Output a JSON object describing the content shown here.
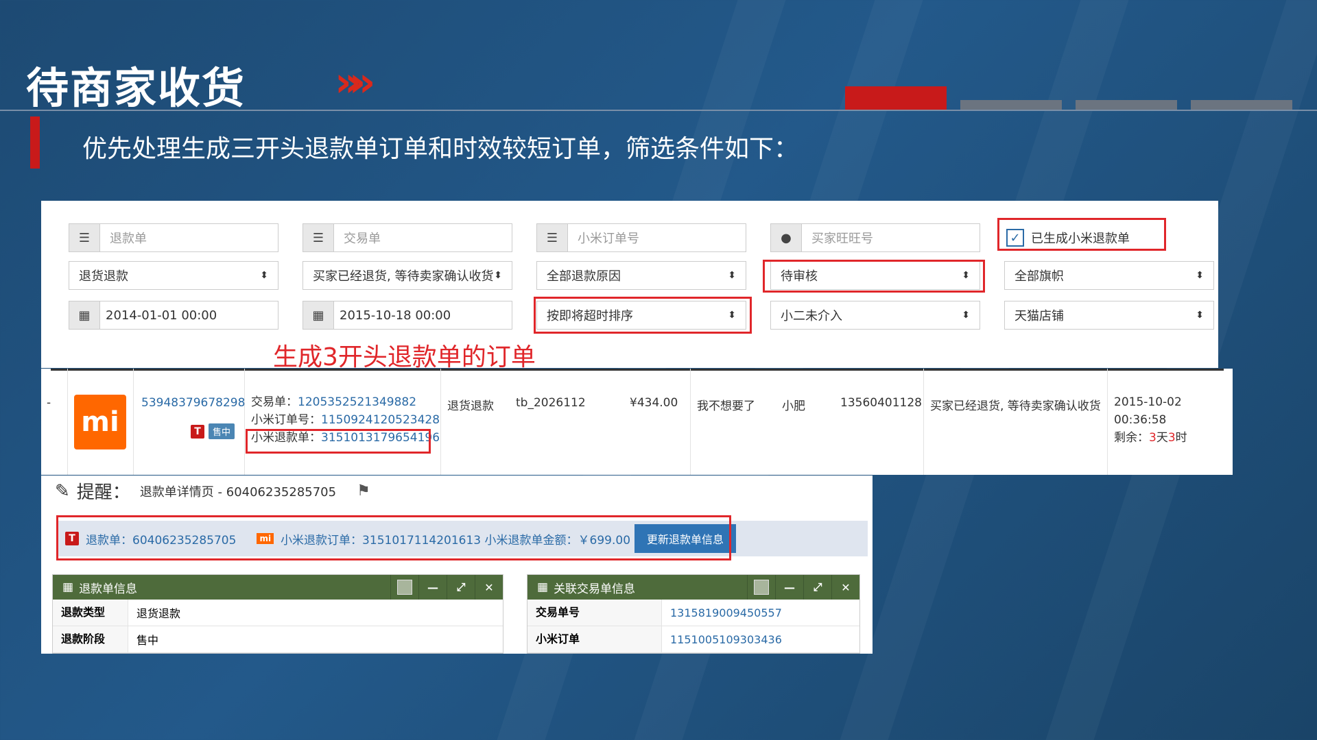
{
  "slide": {
    "title": "待商家收货",
    "subtitle": "优先处理生成三开头退款单订单和时效较短订单，筛选条件如下：",
    "arrows": "»»"
  },
  "colors": {
    "accent_red": "#d9291c",
    "dark_blue": "#1d4a73",
    "link": "#2a6aa6",
    "widget_green": "#4e6b3b"
  },
  "filters": {
    "refund_no_placeholder": "退款单",
    "trade_no_placeholder": "交易单",
    "mi_order_placeholder": "小米订单号",
    "buyer_placeholder": "买家旺旺号",
    "checkbox_label": "已生成小米退款单",
    "refund_type": "退货退款",
    "refund_status": "买家已经退货, 等待卖家确认收货",
    "reason": "全部退款原因",
    "review": "待审核",
    "flagship": "全部旗帜",
    "start_date": "2014-01-01 00:00",
    "end_date": "2015-10-18 00:00",
    "sort": "按即将超时排序",
    "intervention": "小二未介入",
    "shop": "天猫店铺"
  },
  "annotation": "生成3开头退款单的订单",
  "order": {
    "dash": "-",
    "logo": "mi",
    "order_id": "53948379678298",
    "t_badge": "T",
    "status_badge": "售中",
    "trade_label": "交易单：",
    "trade_no": "1205352521349882",
    "mi_order_label": "小米订单号：",
    "mi_order_no": "1150924120523428",
    "mi_refund_label": "小米退款单：",
    "mi_refund_no": "3151013179654196",
    "type": "退货退款",
    "buyer": "tb_2026112",
    "amount": "¥434.00",
    "reason": "我不想要了",
    "name": "小肥",
    "phone": "13560401128",
    "status": "买家已经退货, 等待卖家确认收货",
    "time": "2015-10-02 00:36:58",
    "remain_label": "剩余：",
    "remain_days": "3",
    "remain_day_unit": "天",
    "remain_hours": "3",
    "remain_hour_unit": "时"
  },
  "reminder": {
    "title": "提醒：",
    "detail": "退款单详情页 - 60406235285705",
    "refund_label": "退款单：60406235285705",
    "mi_logo": "mi",
    "mi_refund_text": "小米退款订单：3151017114201613 小米退款单金额：￥699.00",
    "update_button": "更新退款单信息"
  },
  "refund_widget": {
    "title": "退款单信息",
    "rows": [
      {
        "k": "退款类型",
        "v": "退货退款"
      },
      {
        "k": "退款阶段",
        "v": "售中"
      }
    ]
  },
  "trade_widget": {
    "title": "关联交易单信息",
    "rows": [
      {
        "k": "交易单号",
        "v": "1315819009450557"
      },
      {
        "k": "小米订单",
        "v": "1151005109303436"
      }
    ]
  }
}
